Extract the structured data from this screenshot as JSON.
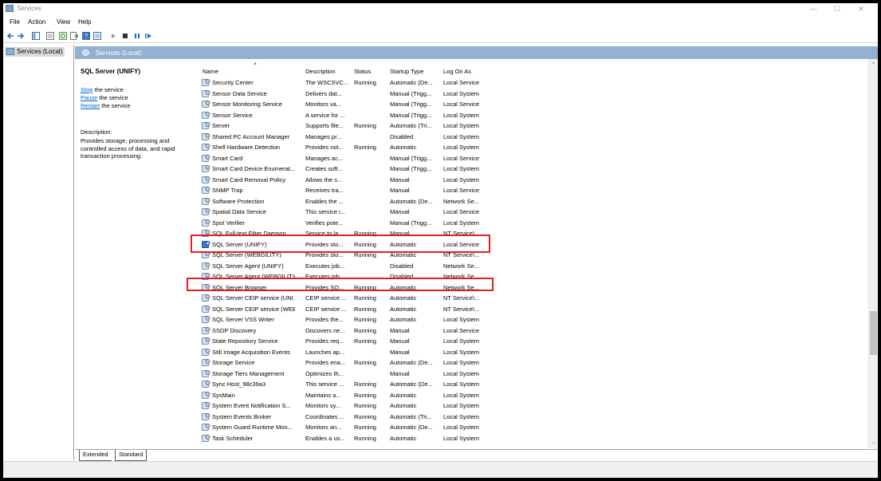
{
  "window": {
    "title": "Services"
  },
  "menu": [
    "File",
    "Action",
    "View",
    "Help"
  ],
  "tree": {
    "root_label": "Services (Local)"
  },
  "pane": {
    "header": "Services (Local)"
  },
  "detail": {
    "service_name": "SQL Server (UNIFY)",
    "links": [
      {
        "link": "Stop",
        "rest": " the service"
      },
      {
        "link": "Pause",
        "rest": " the service"
      },
      {
        "link": "Restart",
        "rest": " the service"
      }
    ],
    "description_label": "Description:",
    "description_text": "Provides storage, processing and controlled access of data, and rapid transaction processing."
  },
  "table": {
    "columns": [
      "Name",
      "Description",
      "Status",
      "Startup Type",
      "Log On As"
    ],
    "rows": [
      {
        "name": "Security Center",
        "desc": "The WSCSVC...",
        "status": "Running",
        "startup": "Automatic (De...",
        "logon": "Local Service"
      },
      {
        "name": "Sensor Data Service",
        "desc": "Delivers dat...",
        "status": "",
        "startup": "Manual (Trigg...",
        "logon": "Local System"
      },
      {
        "name": "Sensor Monitoring Service",
        "desc": "Monitors va...",
        "status": "",
        "startup": "Manual (Trigg...",
        "logon": "Local Service"
      },
      {
        "name": "Sensor Service",
        "desc": "A service for ...",
        "status": "",
        "startup": "Manual (Trigg...",
        "logon": "Local System"
      },
      {
        "name": "Server",
        "desc": "Supports file...",
        "status": "Running",
        "startup": "Automatic (Tri...",
        "logon": "Local System"
      },
      {
        "name": "Shared PC Account Manager",
        "desc": "Manages pr...",
        "status": "",
        "startup": "Disabled",
        "logon": "Local System"
      },
      {
        "name": "Shell Hardware Detection",
        "desc": "Provides not...",
        "status": "Running",
        "startup": "Automatic",
        "logon": "Local System"
      },
      {
        "name": "Smart Card",
        "desc": "Manages ac...",
        "status": "",
        "startup": "Manual (Trigg...",
        "logon": "Local Service"
      },
      {
        "name": "Smart Card Device Enumerat...",
        "desc": "Creates soft...",
        "status": "",
        "startup": "Manual (Trigg...",
        "logon": "Local System"
      },
      {
        "name": "Smart Card Removal Policy",
        "desc": "Allows the s...",
        "status": "",
        "startup": "Manual",
        "logon": "Local System"
      },
      {
        "name": "SNMP Trap",
        "desc": "Receives tra...",
        "status": "",
        "startup": "Manual",
        "logon": "Local Service"
      },
      {
        "name": "Software Protection",
        "desc": "Enables the ...",
        "status": "",
        "startup": "Automatic (De...",
        "logon": "Network Se..."
      },
      {
        "name": "Spatial Data Service",
        "desc": "This service i...",
        "status": "",
        "startup": "Manual",
        "logon": "Local Service"
      },
      {
        "name": "Spot Verifier",
        "desc": "Verifies pote...",
        "status": "",
        "startup": "Manual (Trigg...",
        "logon": "Local System"
      },
      {
        "name": "SQL Full-text Filter Daemon ...",
        "desc": "Service to la...",
        "status": "Running",
        "startup": "Manual",
        "logon": "NT Service\\..."
      },
      {
        "name": "SQL Server (UNIFY)",
        "desc": "Provides sto...",
        "status": "Running",
        "startup": "Automatic",
        "logon": "Local Service"
      },
      {
        "name": "SQL Server (WEBGILITY)",
        "desc": "Provides sto...",
        "status": "Running",
        "startup": "Automatic",
        "logon": "NT Service\\..."
      },
      {
        "name": "SQL Server Agent (UNIFY)",
        "desc": "Executes job...",
        "status": "",
        "startup": "Disabled",
        "logon": "Network Se..."
      },
      {
        "name": "SQL Server Agent (WEBGILITY)",
        "desc": "Executes job...",
        "status": "",
        "startup": "Disabled",
        "logon": "Network Se..."
      },
      {
        "name": "SQL Server Browser",
        "desc": "Provides SQ...",
        "status": "Running",
        "startup": "Automatic",
        "logon": "Network Se..."
      },
      {
        "name": "SQL Server CEIP service (UNI...",
        "desc": "CEIP service ...",
        "status": "Running",
        "startup": "Automatic",
        "logon": "NT Service\\..."
      },
      {
        "name": "SQL Server CEIP service (WEB...",
        "desc": "CEIP service ...",
        "status": "Running",
        "startup": "Automatic",
        "logon": "NT Service\\..."
      },
      {
        "name": "SQL Server VSS Writer",
        "desc": "Provides the...",
        "status": "Running",
        "startup": "Automatic",
        "logon": "Local System"
      },
      {
        "name": "SSDP Discovery",
        "desc": "Discovers ne...",
        "status": "Running",
        "startup": "Manual",
        "logon": "Local Service"
      },
      {
        "name": "State Repository Service",
        "desc": "Provides req...",
        "status": "Running",
        "startup": "Manual",
        "logon": "Local System"
      },
      {
        "name": "Still Image Acquisition Events",
        "desc": "Launches ap...",
        "status": "",
        "startup": "Manual",
        "logon": "Local System"
      },
      {
        "name": "Storage Service",
        "desc": "Provides ena...",
        "status": "Running",
        "startup": "Automatic (De...",
        "logon": "Local System"
      },
      {
        "name": "Storage Tiers Management",
        "desc": "Optimizes th...",
        "status": "",
        "startup": "Manual",
        "logon": "Local System"
      },
      {
        "name": "Sync Host_98c39a3",
        "desc": "This service ...",
        "status": "Running",
        "startup": "Automatic (De...",
        "logon": "Local System"
      },
      {
        "name": "SysMain",
        "desc": "Maintains a...",
        "status": "Running",
        "startup": "Automatic",
        "logon": "Local System"
      },
      {
        "name": "System Event Notification S...",
        "desc": "Monitors sy...",
        "status": "Running",
        "startup": "Automatic",
        "logon": "Local System"
      },
      {
        "name": "System Events Broker",
        "desc": "Coordinates ...",
        "status": "Running",
        "startup": "Automatic (Tri...",
        "logon": "Local System"
      },
      {
        "name": "System Guard Runtime Mon...",
        "desc": "Monitors an...",
        "status": "Running",
        "startup": "Automatic (De...",
        "logon": "Local System"
      },
      {
        "name": "Task Scheduler",
        "desc": "Enables a us...",
        "status": "Running",
        "startup": "Automatic",
        "logon": "Local System"
      }
    ],
    "highlighted_rows": [
      "SQL Server (UNIFY)",
      "SQL Server Browser"
    ]
  },
  "tabs": [
    "Extended",
    "Standard"
  ],
  "colors": {
    "highlight": "#e02020",
    "pane_header": "#94b1d1",
    "link": "#0066cc"
  }
}
